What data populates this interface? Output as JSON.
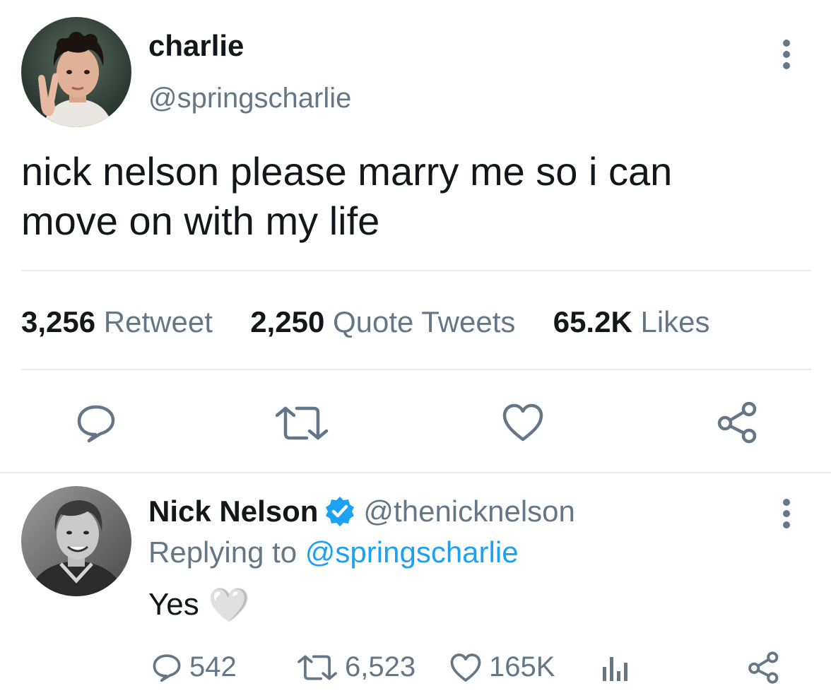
{
  "tweet": {
    "author_name": "charlie",
    "author_handle": "@springscharlie",
    "text_line1": "nick nelson please marry me so i can",
    "text_line2": "move on with my life",
    "stats": {
      "retweets_count": "3,256",
      "retweets_label": "Retweet",
      "quotes_count": "2,250",
      "quotes_label": "Quote Tweets",
      "likes_count": "65.2K",
      "likes_label": "Likes"
    },
    "actions": [
      "reply-icon",
      "retweet-icon",
      "like-icon",
      "share-icon"
    ]
  },
  "reply": {
    "author_name": "Nick Nelson",
    "verified": true,
    "author_handle": "@thenicknelson",
    "replying_prefix": "Replying to",
    "replying_handle": "@springscharlie",
    "text": "Yes",
    "emoji": "🤍",
    "counts": {
      "replies": "542",
      "retweets": "6,523",
      "likes": "165K"
    },
    "actions": [
      "reply-icon",
      "retweet-icon",
      "like-icon",
      "analytics-icon",
      "share-icon"
    ]
  },
  "colors": {
    "accent": "#1da1f2",
    "muted": "#657786",
    "divider": "#e6ecf0",
    "text": "#14171a"
  }
}
